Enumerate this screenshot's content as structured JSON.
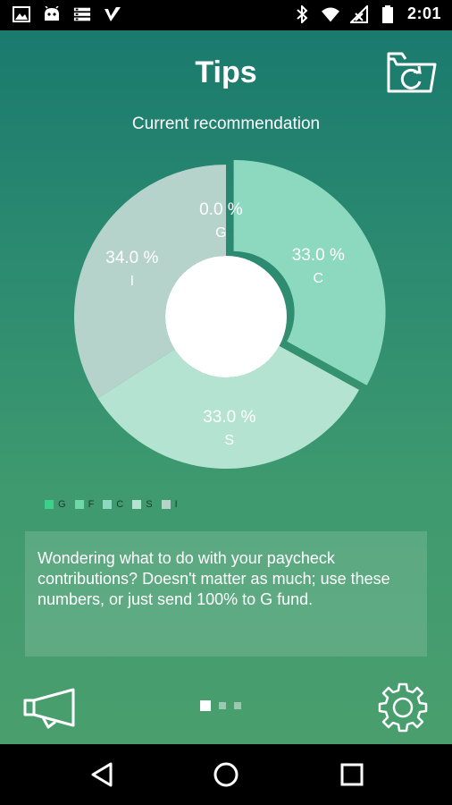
{
  "status_bar": {
    "time": "2:01",
    "left_icons": [
      "image-icon",
      "android-icon",
      "server-icon",
      "checkmark-badge-icon"
    ],
    "right_icons": [
      "bluetooth-icon",
      "wifi-icon",
      "signal-icon",
      "battery-icon"
    ]
  },
  "header": {
    "title": "Tips",
    "refresh_icon": "folder-refresh-icon"
  },
  "subtitle": "Current recommendation",
  "chart_data": {
    "type": "pie",
    "title": "",
    "slices": [
      {
        "label": "G",
        "value": 0.0,
        "display": "0.0 %",
        "color": "#3dd08a"
      },
      {
        "label": "F",
        "value": 0.0,
        "display": "",
        "color": "#6fd8a8"
      },
      {
        "label": "C",
        "value": 33.0,
        "display": "33.0 %",
        "color": "#8dd9bf"
      },
      {
        "label": "S",
        "value": 33.0,
        "display": "33.0 %",
        "color": "#b5e3d1"
      },
      {
        "label": "I",
        "value": 34.0,
        "display": "34.0 %",
        "color": "#b5d3cb"
      }
    ],
    "legend": [
      "G",
      "F",
      "C",
      "S",
      "I"
    ],
    "legend_position": "bottom-left",
    "center_color": "#ffffff"
  },
  "tip": {
    "text": "Wondering what to do with your paycheck contributions? Doesn't matter as much; use these numbers, or just send 100% to G fund."
  },
  "pager": {
    "count": 3,
    "active": 0
  },
  "footer": {
    "left_icon": "megaphone-icon",
    "right_icon": "gear-icon"
  },
  "nav_bar": {
    "icons": [
      "back-icon",
      "home-icon",
      "recents-icon"
    ]
  }
}
